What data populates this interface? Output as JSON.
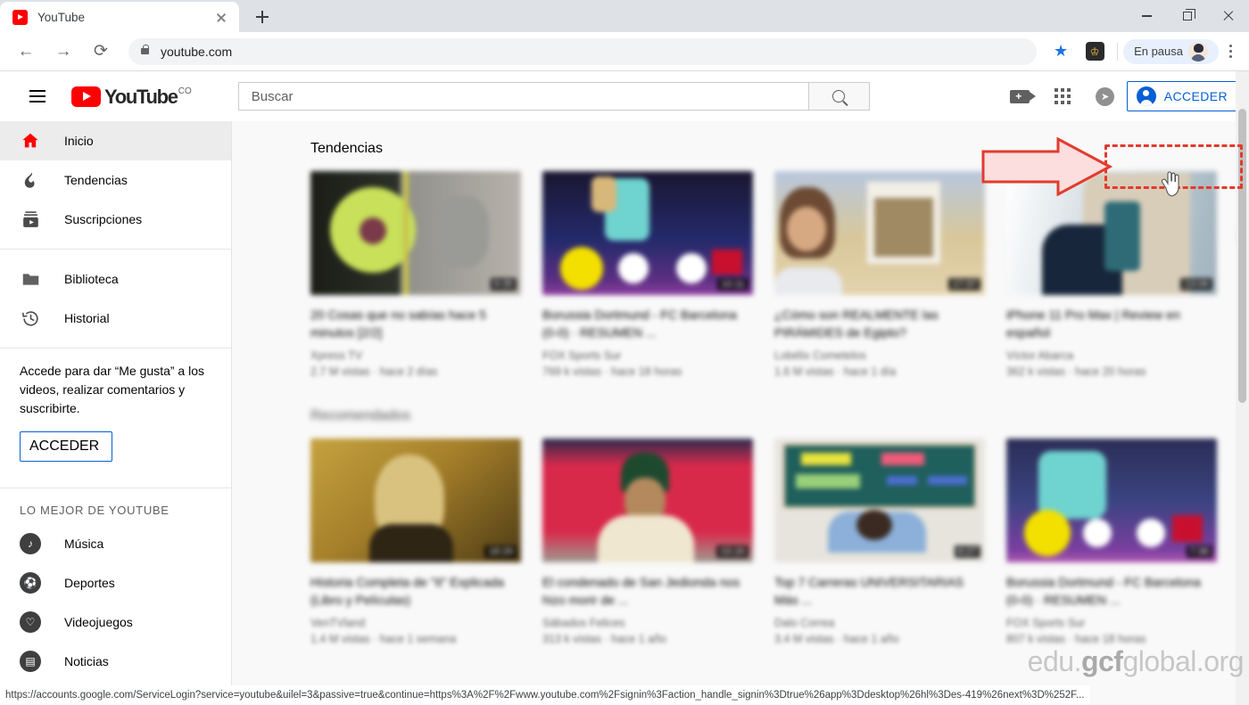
{
  "browser": {
    "tab": {
      "title": "YouTube",
      "favicon": "youtube-favicon",
      "close_icon": "close-icon"
    },
    "new_tab_label": "+",
    "window_controls": {
      "minimize": "minimize-icon",
      "maximize": "maximize-icon",
      "close": "close-icon"
    },
    "nav": {
      "back": "←",
      "forward": "→",
      "reload": "⟳"
    },
    "omnibox": {
      "url": "youtube.com",
      "lock_icon": "lock-icon"
    },
    "toolbar_right": {
      "bookmark_star": "★",
      "extension_crown": "♔",
      "profile_label": "En pausa",
      "menu_icon": "kebab-menu-icon"
    },
    "status_url": "https://accounts.google.com/ServiceLogin?service=youtube&uilel=3&passive=true&continue=https%3A%2F%2Fwww.youtube.com%2Fsignin%3Faction_handle_signin%3Dtrue%26app%3Ddesktop%26hl%3Des-419%26next%3D%252F..."
  },
  "youtube_header": {
    "menu_icon": "hamburger-menu-icon",
    "logo_word": "YouTube",
    "logo_country": "CO",
    "search_placeholder": "Buscar",
    "search_value": "",
    "search_button_icon": "search-icon",
    "create_icon": "video-camera-add-icon",
    "apps_icon": "apps-grid-icon",
    "notifications_icon": "notifications-bell-icon",
    "signin_label": "ACCEDER"
  },
  "annotations": {
    "arrow_color": "#e23b2e",
    "highlight_color": "#e23b2e",
    "arrow_name": "red-callout-arrow",
    "rect_name": "red-dashed-highlight",
    "cursor_name": "hand-cursor"
  },
  "sidebar": {
    "primary": [
      {
        "label": "Inicio",
        "icon": "home-icon",
        "active": true
      },
      {
        "label": "Tendencias",
        "icon": "trending-flame-icon",
        "active": false
      },
      {
        "label": "Suscripciones",
        "icon": "subscriptions-icon",
        "active": false
      }
    ],
    "secondary": [
      {
        "label": "Biblioteca",
        "icon": "library-folder-icon"
      },
      {
        "label": "Historial",
        "icon": "history-clock-icon"
      }
    ],
    "signin_prompt": "Accede para dar “Me gusta” a los videos, realizar comentarios y suscribirte.",
    "signin_button": "ACCEDER",
    "best_of_heading": "LO MEJOR DE YOUTUBE",
    "best_of": [
      {
        "label": "Música",
        "icon": "music-note-icon",
        "glyph": "♪"
      },
      {
        "label": "Deportes",
        "icon": "sports-ball-icon",
        "glyph": "⚽"
      },
      {
        "label": "Videojuegos",
        "icon": "gaming-controller-icon",
        "glyph": "🎮"
      },
      {
        "label": "Noticias",
        "icon": "news-paper-icon",
        "glyph": "📰"
      }
    ]
  },
  "content": {
    "shelves": [
      {
        "title": "Tendencias",
        "blurred_title": false,
        "cards": [
          {
            "title": "20 Cosas que no sabías hace 5 minutos [2/2]",
            "channel": "Xpress TV",
            "meta": "2.7 M vistas · hace 2 días",
            "duration": "9:35",
            "thumb": "thumb-dark-green-object"
          },
          {
            "title": "Borussia Dortmund - FC Barcelona (0-0) · RESUMEN ...",
            "channel": "FOX Sports Sur",
            "meta": "769 k vistas · hace 18 horas",
            "duration": "10:11",
            "thumb": "thumb-soccer-champions"
          },
          {
            "title": "¿Cómo son REALMENTE las PIRÁMIDES de Egipto?",
            "channel": "Lobélix Cometelos",
            "meta": "1.6 M vistas · hace 1 día",
            "duration": "17:37",
            "thumb": "thumb-pyramids-desert"
          },
          {
            "title": "iPhone 11 Pro Max | Review en español",
            "channel": "Víctor Abarca",
            "meta": "362 k vistas · hace 20 horas",
            "duration": "13:06",
            "thumb": "thumb-phone-review"
          }
        ]
      },
      {
        "title": "Recomendados",
        "blurred_title": true,
        "cards": [
          {
            "title": "Historia Completa de \"It\" Explicada (Libro y Películas)",
            "channel": "VenTVland",
            "meta": "1.4 M vistas · hace 1 semana",
            "duration": "18:29",
            "thumb": "thumb-sepia-portrait"
          },
          {
            "title": "El condenado de San Jedionda nos hizo morir de ...",
            "channel": "Sábados Felices",
            "meta": "313 k vistas · hace 1 año",
            "duration": "03:26",
            "thumb": "thumb-red-stage-comedy"
          },
          {
            "title": "Top 7 Carreras UNIVERSITARIAS Más ...",
            "channel": "Dalo Correa",
            "meta": "3.4 M vistas · hace 1 año",
            "duration": "6:27",
            "thumb": "thumb-chalkboard-class"
          },
          {
            "title": "Borussia Dortmund - FC Barcelona (0-0) · RESUMEN ...",
            "channel": "FOX Sports Sur",
            "meta": "807 k vistas · hace 18 horas",
            "duration": "7:38",
            "thumb": "thumb-soccer-champions-2"
          }
        ]
      }
    ],
    "scroll_next_icon": "chevron-right-circle-icon"
  },
  "watermark": {
    "prefix": "edu.",
    "brand": "gcf",
    "suffix": "global.org"
  }
}
